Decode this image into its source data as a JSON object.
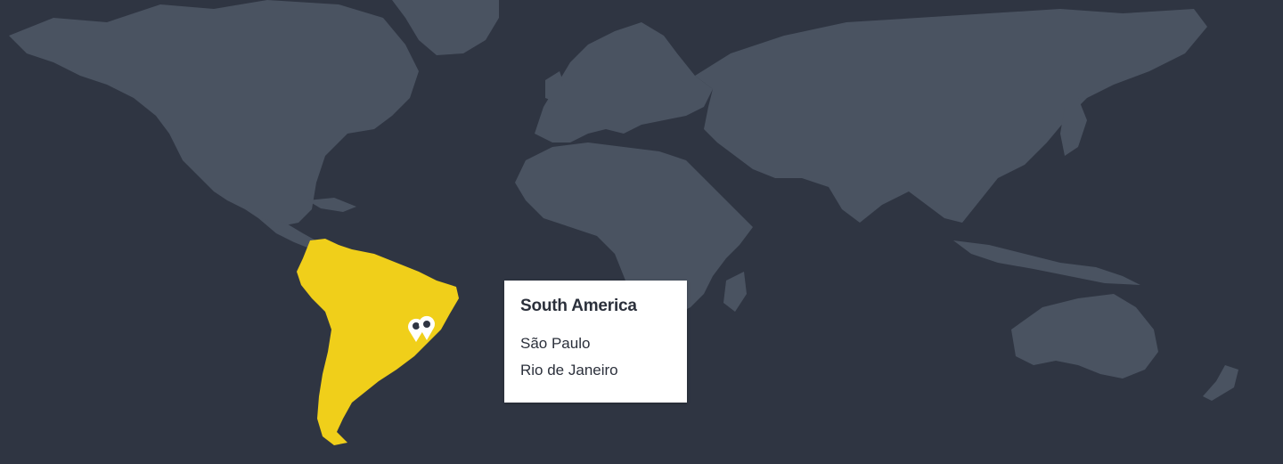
{
  "map": {
    "active_region": "South America",
    "colors": {
      "background": "#2f3542",
      "land": "#4a5361",
      "active_region": "#f0cf1a",
      "marker": "#ffffff"
    }
  },
  "tooltip": {
    "title": "South America",
    "cities": [
      "São Paulo",
      "Rio de Janeiro"
    ]
  },
  "markers": [
    {
      "city": "São Paulo",
      "icon": "location-pin-icon"
    },
    {
      "city": "Rio de Janeiro",
      "icon": "location-pin-icon"
    }
  ]
}
